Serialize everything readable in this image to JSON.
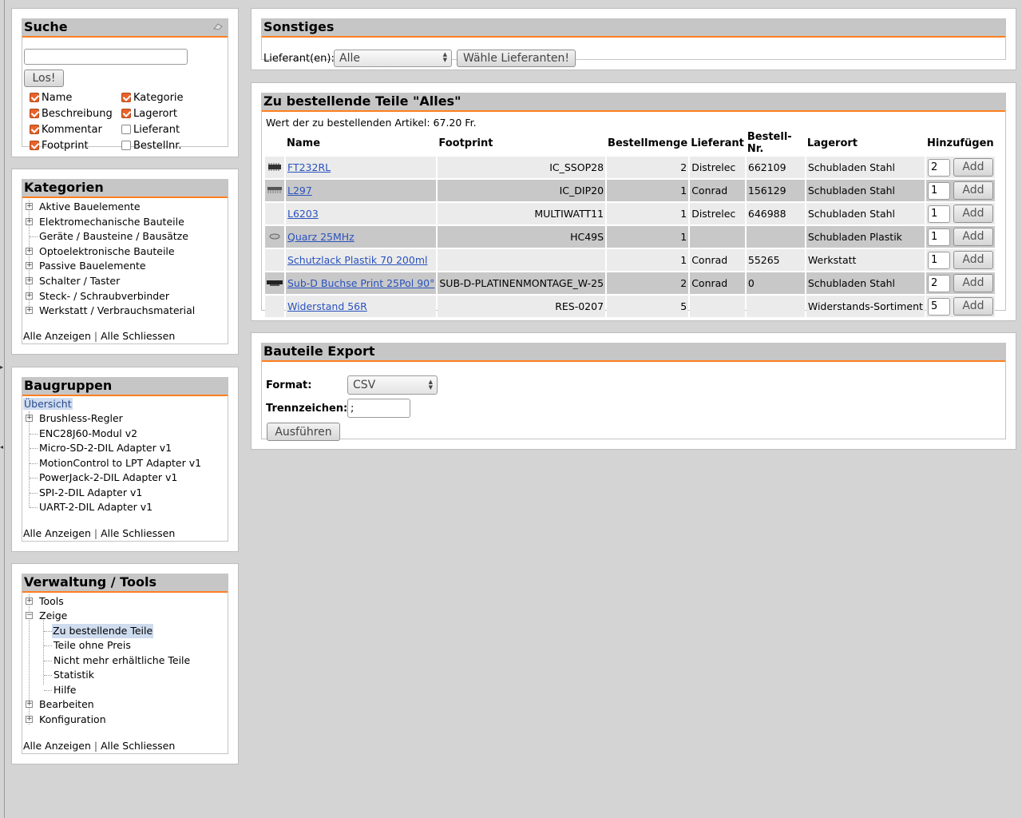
{
  "search": {
    "title": "Suche",
    "input_value": "",
    "button": "Los!",
    "options": [
      {
        "label": "Name",
        "checked": true
      },
      {
        "label": "Kategorie",
        "checked": true
      },
      {
        "label": "Beschreibung",
        "checked": true
      },
      {
        "label": "Lagerort",
        "checked": true
      },
      {
        "label": "Kommentar",
        "checked": true
      },
      {
        "label": "Lieferant",
        "checked": false
      },
      {
        "label": "Footprint",
        "checked": true
      },
      {
        "label": "Bestellnr.",
        "checked": false
      }
    ]
  },
  "categories": {
    "title": "Kategorien",
    "items": [
      {
        "label": "Aktive Bauelemente",
        "expandable": true
      },
      {
        "label": "Elektromechanische Bauteile",
        "expandable": true
      },
      {
        "label": "Geräte / Bausteine / Bausätze",
        "expandable": false
      },
      {
        "label": "Optoelektronische Bauteile",
        "expandable": true
      },
      {
        "label": "Passive Bauelemente",
        "expandable": true
      },
      {
        "label": "Schalter / Taster",
        "expandable": true
      },
      {
        "label": "Steck- / Schraubverbinder",
        "expandable": true
      },
      {
        "label": "Werkstatt / Verbrauchsmaterial",
        "expandable": true
      }
    ],
    "show_all": "Alle Anzeigen",
    "separator": "|",
    "close_all": "Alle Schliessen"
  },
  "assemblies": {
    "title": "Baugruppen",
    "overview": "Übersicht",
    "items": [
      {
        "label": "Brushless-Regler",
        "expandable": true
      },
      {
        "label": "ENC28J60-Modul v2",
        "expandable": false
      },
      {
        "label": "Micro-SD-2-DIL Adapter v1",
        "expandable": false
      },
      {
        "label": "MotionControl to LPT Adapter v1",
        "expandable": false
      },
      {
        "label": "PowerJack-2-DIL Adapter v1",
        "expandable": false
      },
      {
        "label": "SPI-2-DIL Adapter v1",
        "expandable": false
      },
      {
        "label": "UART-2-DIL Adapter v1",
        "expandable": false
      }
    ],
    "show_all": "Alle Anzeigen",
    "separator": "|",
    "close_all": "Alle Schliessen"
  },
  "tools": {
    "title": "Verwaltung / Tools",
    "tools_label": "Tools",
    "zeige_label": "Zeige",
    "zeige_children": [
      "Zu bestellende Teile",
      "Teile ohne Preis",
      "Nicht mehr erhältliche Teile",
      "Statistik",
      "Hilfe"
    ],
    "bearbeiten_label": "Bearbeiten",
    "konfiguration_label": "Konfiguration",
    "show_all": "Alle Anzeigen",
    "separator": "|",
    "close_all": "Alle Schliessen"
  },
  "misc": {
    "title": "Sonstiges",
    "supplier_label": "Lieferant(en):",
    "supplier_value": "Alle",
    "choose_button": "Wähle Lieferanten!"
  },
  "order": {
    "title": "Zu bestellende Teile \"Alles\"",
    "total": "Wert der zu bestellenden Artikel: 67.20 Fr.",
    "columns": [
      "Name",
      "Footprint",
      "Bestellmenge",
      "Lieferant",
      "Bestell-Nr.",
      "Lagerort",
      "Hinzufügen"
    ],
    "add_label": "Add",
    "rows": [
      {
        "name": "FT232RL",
        "footprint": "IC_SSOP28",
        "qty": "2",
        "supplier": "Distrelec",
        "order_nr": "662109",
        "location": "Schubladen Stahl",
        "add_qty": "2",
        "thumb": "ic"
      },
      {
        "name": "L297",
        "footprint": "IC_DIP20",
        "qty": "1",
        "supplier": "Conrad",
        "order_nr": "156129",
        "location": "Schubladen Stahl",
        "add_qty": "1",
        "thumb": "dip"
      },
      {
        "name": "L6203",
        "footprint": "MULTIWATT11",
        "qty": "1",
        "supplier": "Distrelec",
        "order_nr": "646988",
        "location": "Schubladen Stahl",
        "add_qty": "1",
        "thumb": ""
      },
      {
        "name": "Quarz 25MHz",
        "footprint": "HC49S",
        "qty": "1",
        "supplier": "",
        "order_nr": "",
        "location": "Schubladen Plastik",
        "add_qty": "1",
        "thumb": "crystal"
      },
      {
        "name": "Schutzlack Plastik 70 200ml",
        "footprint": "",
        "qty": "1",
        "supplier": "Conrad",
        "order_nr": "55265",
        "location": "Werkstatt",
        "add_qty": "1",
        "thumb": ""
      },
      {
        "name": "Sub-D Buchse Print 25Pol 90°",
        "footprint": "SUB-D-PLATINENMONTAGE_W-25",
        "qty": "2",
        "supplier": "Conrad",
        "order_nr": "0",
        "location": "Schubladen Stahl",
        "add_qty": "2",
        "thumb": "subd"
      },
      {
        "name": "Widerstand 56R",
        "footprint": "RES-0207",
        "qty": "5",
        "supplier": "",
        "order_nr": "",
        "location": "Widerstands-Sortiment",
        "add_qty": "5",
        "thumb": ""
      }
    ]
  },
  "export": {
    "title": "Bauteile Export",
    "format_label": "Format:",
    "format_value": "CSV",
    "separator_label": "Trennzeichen:",
    "separator_value": ";",
    "run_button": "Ausführen"
  },
  "colors": {
    "accent": "#ff7f1f",
    "header_bg": "#c6c6c6",
    "link": "#2a52be",
    "checkbox": "#e8622a"
  }
}
